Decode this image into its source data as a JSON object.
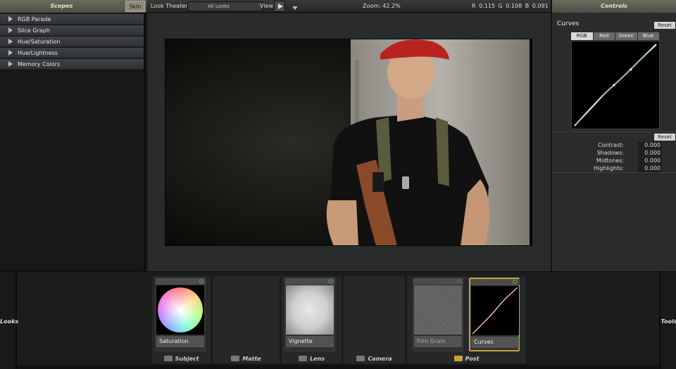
{
  "scopes": {
    "title": "Scopes",
    "skin_label": "Skin",
    "items": [
      {
        "label": "RGB Parade"
      },
      {
        "label": "Slice Graph"
      },
      {
        "label": "Hue/Saturation"
      },
      {
        "label": "Hue/Lightness"
      },
      {
        "label": "Memory Colors"
      }
    ]
  },
  "topbar": {
    "look_theater": "Look Theater",
    "looks_select": "All Looks",
    "view_label": "View",
    "zoom": "Zoom:  42.2%",
    "rgb": "R 0.115   G 0.108   B 0.091"
  },
  "controls": {
    "title": "Controls",
    "curves_title": "Curves",
    "reset_label": "Reset",
    "curve_tabs": [
      "RGB",
      "Red",
      "Green",
      "Blue"
    ],
    "active_tab": "RGB",
    "params": [
      {
        "label": "Contrast:",
        "value": "0.000"
      },
      {
        "label": "Shadows:",
        "value": "0.000"
      },
      {
        "label": "Midtones:",
        "value": "0.000"
      },
      {
        "label": "Highlights:",
        "value": "0.000"
      }
    ]
  },
  "bottom": {
    "looks_label": "Looks",
    "tools_label": "Tools",
    "sections": [
      {
        "label": "Subject",
        "tools": [
          {
            "label": "Saturation",
            "icon": "color-wheel-icon"
          }
        ]
      },
      {
        "label": "Matte",
        "tools": []
      },
      {
        "label": "Lens",
        "tools": [
          {
            "label": "Vignette",
            "icon": "vignette-icon"
          }
        ]
      },
      {
        "label": "Camera",
        "tools": []
      },
      {
        "label": "Post",
        "tools": [
          {
            "label": "Film Grain",
            "icon": "grain-icon"
          },
          {
            "label": "Curves",
            "icon": "curve-icon"
          }
        ]
      }
    ]
  },
  "colors": {
    "header": "#5c5c52",
    "accent_selected": "#c8a23a",
    "power_on": "#7fc44a"
  }
}
